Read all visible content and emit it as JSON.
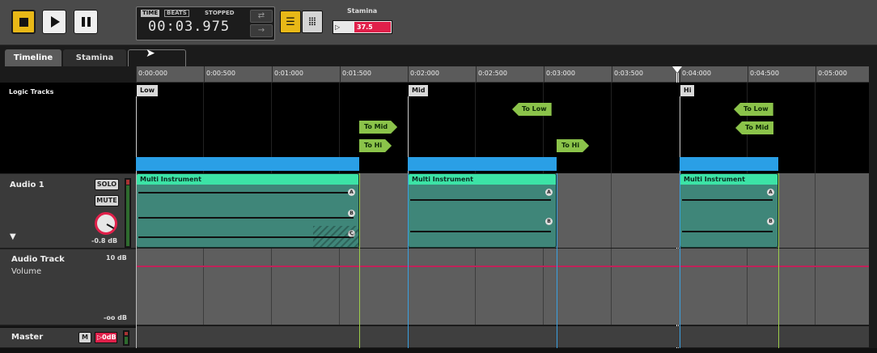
{
  "transport": {
    "time_tag": "TIME",
    "beats_tag": "BEATS",
    "status": "STOPPED",
    "time": "00:03.975"
  },
  "stamina": {
    "label": "Stamina",
    "value": "37.5",
    "fill_fraction": 0.37
  },
  "tabs": [
    {
      "label": "Timeline",
      "active": true
    },
    {
      "label": "Stamina",
      "active": false
    },
    {
      "label": "",
      "active": false
    }
  ],
  "ruler": [
    "0:00:000",
    "0:00:500",
    "0:01:000",
    "0:01:500",
    "0:02:000",
    "0:02:500",
    "0:03:000",
    "0:03:500",
    "0:04:000",
    "0:04:500",
    "0:05:000"
  ],
  "logic": {
    "header": "Logic Tracks",
    "sections": [
      "Low",
      "Mid",
      "Hi"
    ],
    "flags": [
      "To Mid",
      "To Hi",
      "To Low",
      "To Hi",
      "To Low",
      "To Mid"
    ]
  },
  "audio1": {
    "name": "Audio 1",
    "solo": "SOLO",
    "mute": "MUTE",
    "gain": "-0.8 dB",
    "clip_title": "Multi Instrument",
    "markers": [
      "A",
      "B",
      "C"
    ]
  },
  "automation": {
    "name": "Audio Track",
    "param": "Volume",
    "max": "10 dB",
    "min": "-oo dB"
  },
  "master": {
    "name": "Master",
    "m": "M",
    "level": "0dB"
  },
  "colors": {
    "accent_yellow": "#e8b817",
    "logic_blue": "#2a9fe6",
    "flag_green": "#8bc34a",
    "clip_header": "#3ce3a6",
    "stamina_red": "#e0204a"
  }
}
